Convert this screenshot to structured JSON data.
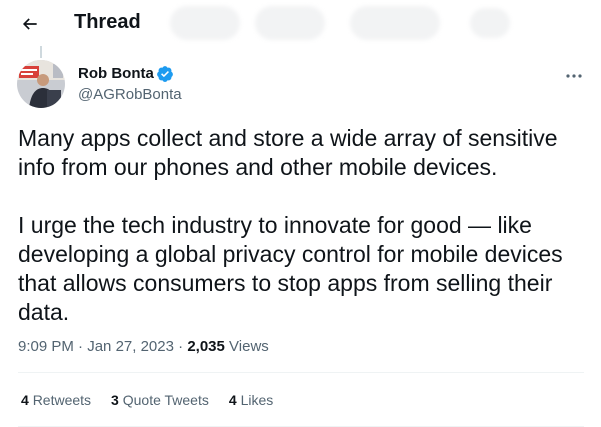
{
  "header": {
    "title": "Thread",
    "back_icon": "arrow-left-icon"
  },
  "tweet": {
    "author": {
      "name": "Rob Bonta",
      "handle": "@AGRobBonta",
      "verified": true,
      "verified_color": "#1d9bf0"
    },
    "text": "Many apps collect and store a wide array of sensitive info from our phones and other mobile devices.\n\nI urge the tech industry to innovate for good — like developing a global privacy control for mobile devices that allows consumers to stop apps from selling their data.",
    "time": "9:09 PM",
    "separator": "·",
    "date": "Jan 27, 2023",
    "views_count": "2,035",
    "views_label": "Views"
  },
  "stats": {
    "retweets_count": "4",
    "retweets_label": "Retweets",
    "quotes_count": "3",
    "quotes_label": "Quote Tweets",
    "likes_count": "4",
    "likes_label": "Likes"
  },
  "colors": {
    "text_primary": "#0f1419",
    "text_secondary": "#536471",
    "divider": "#eff3f4",
    "accent": "#1d9bf0"
  }
}
